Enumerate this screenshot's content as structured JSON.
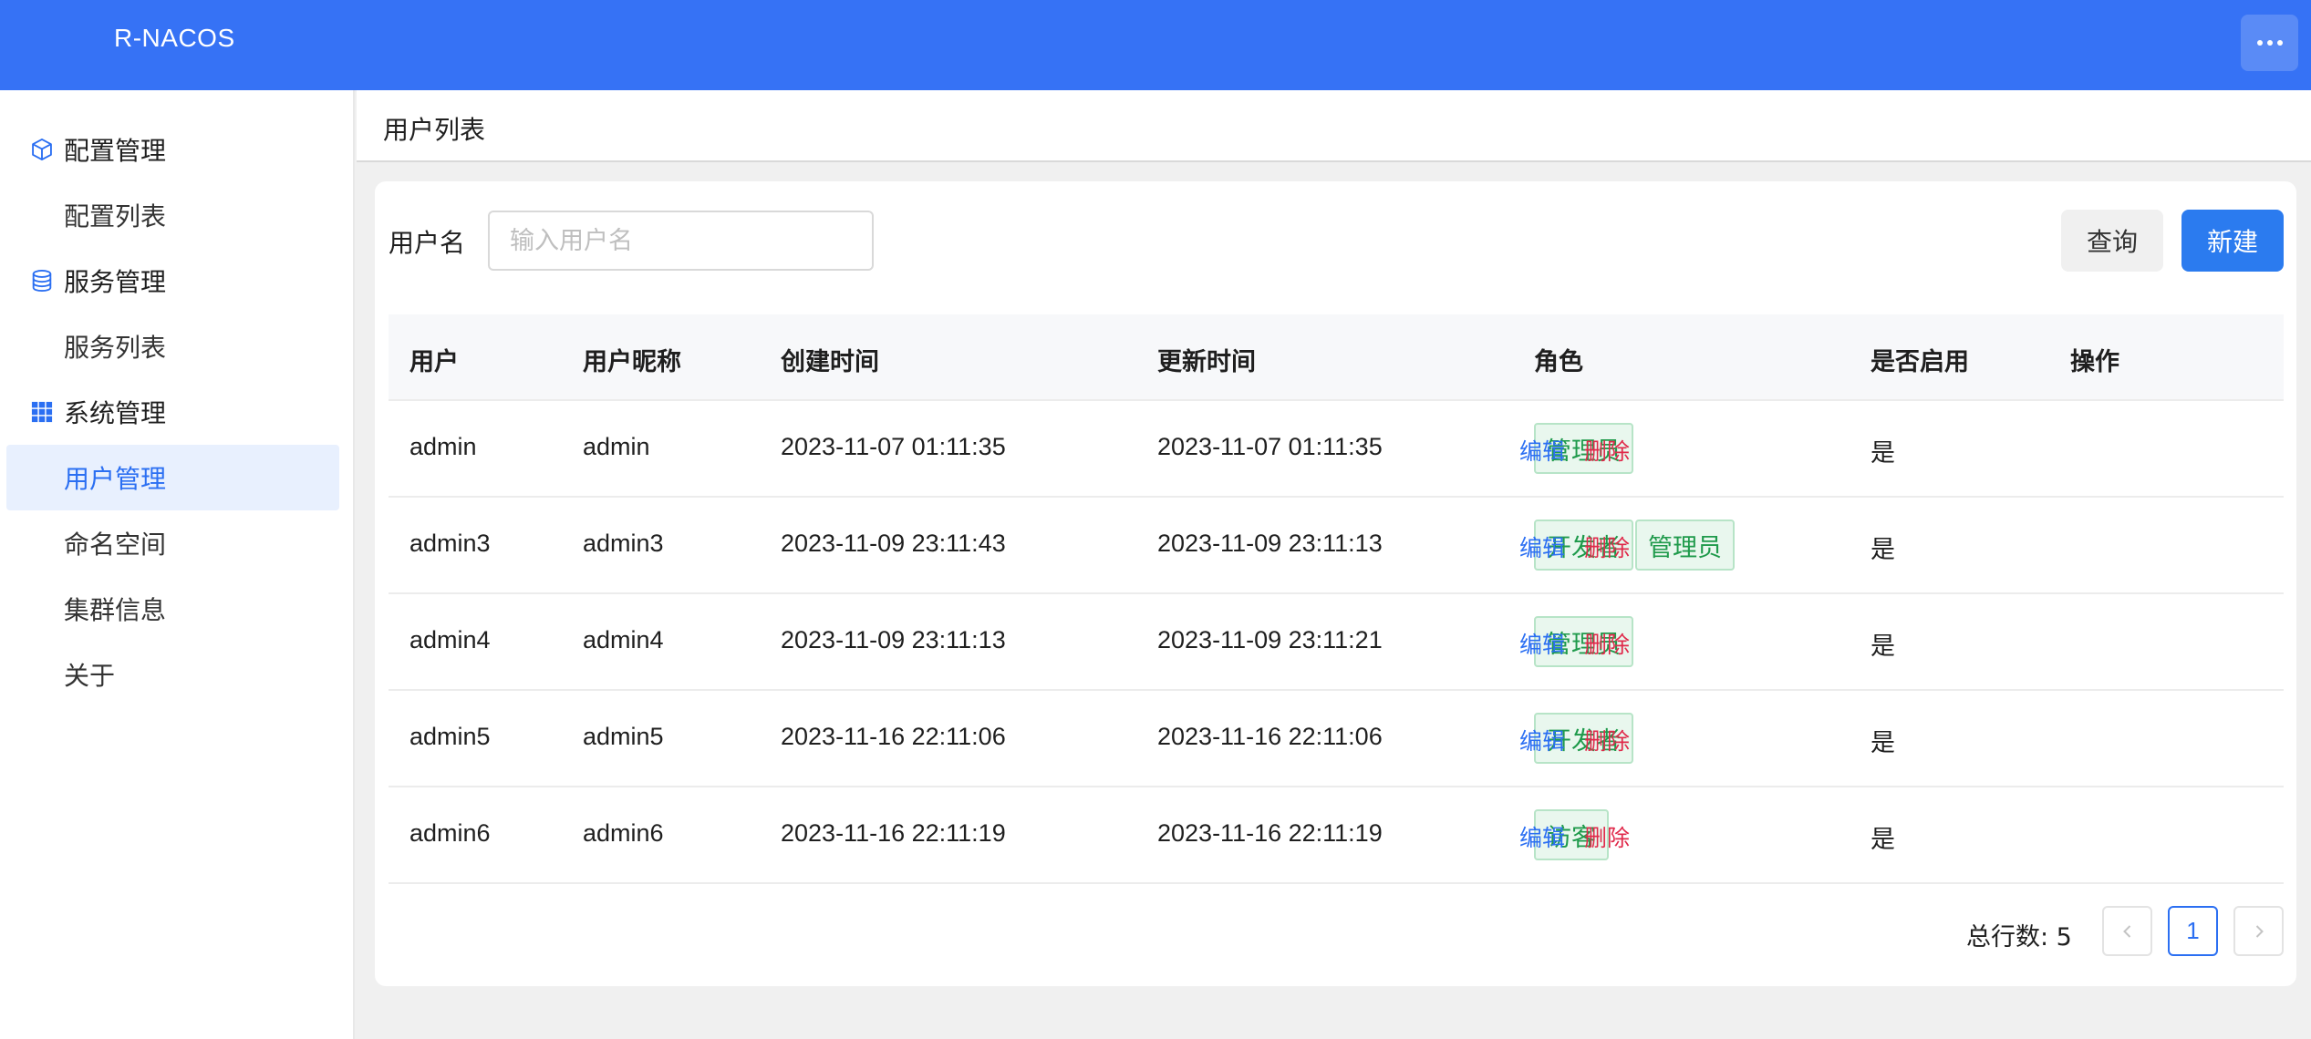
{
  "app": {
    "title": "R-NACOS"
  },
  "header": {
    "more_icon": "more-horizontal-icon"
  },
  "sidebar": {
    "groups": [
      {
        "label": "配置管理",
        "icon": "cube-icon",
        "items": [
          {
            "label": "配置列表",
            "active": false
          }
        ]
      },
      {
        "label": "服务管理",
        "icon": "database-icon",
        "items": [
          {
            "label": "服务列表",
            "active": false
          }
        ]
      },
      {
        "label": "系统管理",
        "icon": "grid-icon",
        "items": [
          {
            "label": "用户管理",
            "active": true
          },
          {
            "label": "命名空间",
            "active": false
          },
          {
            "label": "集群信息",
            "active": false
          },
          {
            "label": "关于",
            "active": false
          }
        ]
      }
    ]
  },
  "page": {
    "title": "用户列表"
  },
  "search": {
    "label": "用户名",
    "placeholder": "输入用户名",
    "value": "",
    "query_label": "查询",
    "new_label": "新建"
  },
  "table": {
    "headers": [
      "用户",
      "用户昵称",
      "创建时间",
      "更新时间",
      "角色",
      "是否启用",
      "操作"
    ],
    "rows": [
      {
        "user": "admin",
        "nickname": "admin",
        "created": "2023-11-07 01:11:35",
        "updated": "2023-11-07 01:11:35",
        "roles": [
          "管理员"
        ],
        "enabled": "是"
      },
      {
        "user": "admin3",
        "nickname": "admin3",
        "created": "2023-11-09 23:11:43",
        "updated": "2023-11-09 23:11:13",
        "roles": [
          "开发者",
          "管理员"
        ],
        "enabled": "是"
      },
      {
        "user": "admin4",
        "nickname": "admin4",
        "created": "2023-11-09 23:11:13",
        "updated": "2023-11-09 23:11:21",
        "roles": [
          "管理员"
        ],
        "enabled": "是"
      },
      {
        "user": "admin5",
        "nickname": "admin5",
        "created": "2023-11-16 22:11:06",
        "updated": "2023-11-16 22:11:06",
        "roles": [
          "开发者"
        ],
        "enabled": "是"
      },
      {
        "user": "admin6",
        "nickname": "admin6",
        "created": "2023-11-16 22:11:19",
        "updated": "2023-11-16 22:11:19",
        "roles": [
          "访客"
        ],
        "enabled": "是"
      }
    ],
    "actions": {
      "edit": "编辑",
      "delete": "删除"
    }
  },
  "pagination": {
    "total_text": "总行数: 5",
    "current_page": "1",
    "prev_icon": "chevron-left-icon",
    "next_icon": "chevron-right-icon"
  },
  "colors": {
    "header_bg": "#3672f5",
    "primary": "#2b7bef",
    "active_bg": "#e8f0fe",
    "tag_green": "#1f9a4b",
    "danger": "#e0294a"
  }
}
